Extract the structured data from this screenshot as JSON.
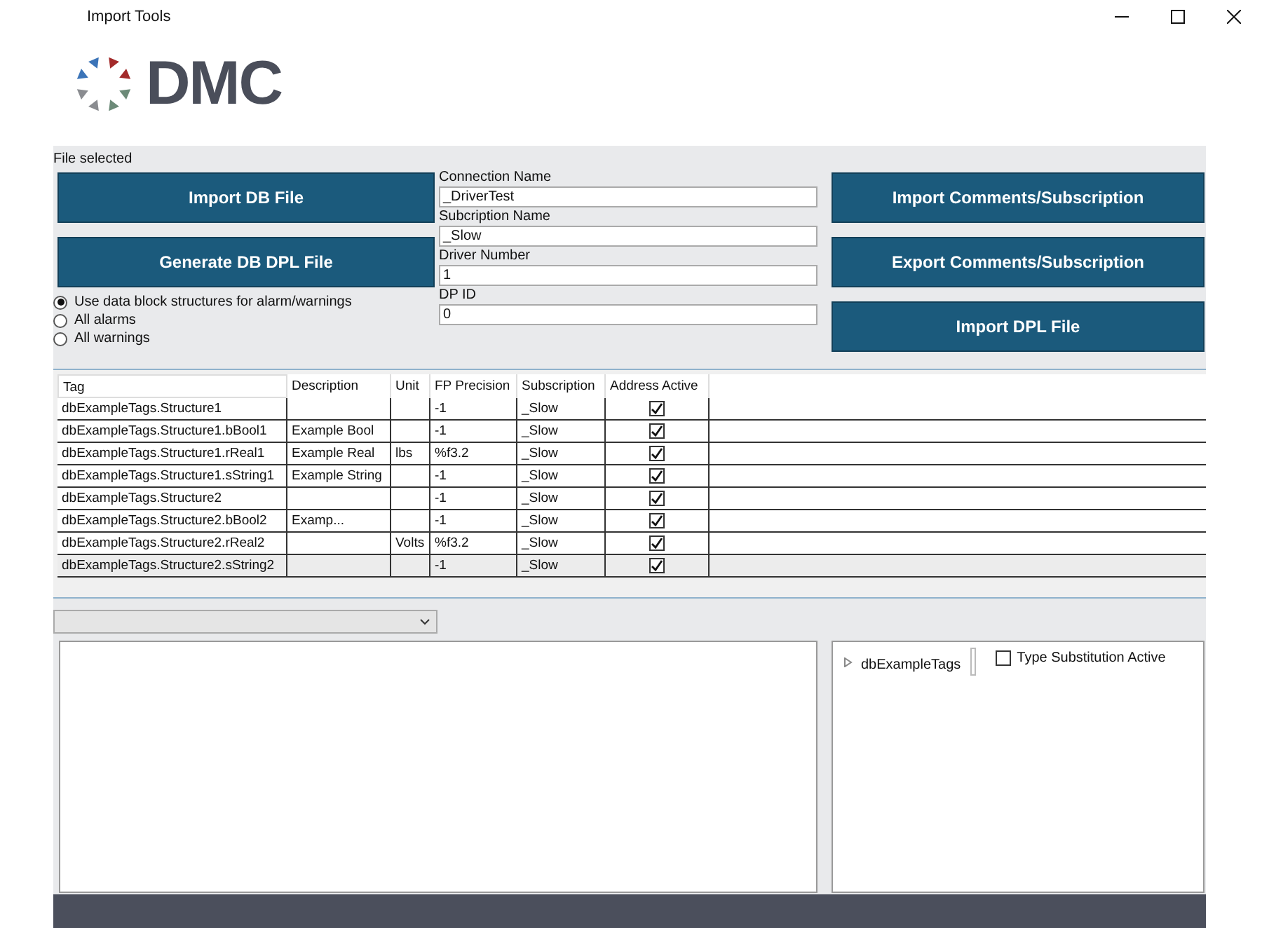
{
  "window": {
    "title": "Import Tools"
  },
  "logo": {
    "text": "DMC"
  },
  "status": "File selected",
  "left_buttons": [
    "Import DB File",
    "Generate DB DPL File"
  ],
  "radios": [
    {
      "label": "Use data block structures for alarm/warnings",
      "selected": true
    },
    {
      "label": "All alarms",
      "selected": false
    },
    {
      "label": "All warnings",
      "selected": false
    }
  ],
  "fields": [
    {
      "label": "Connection Name",
      "value": "_DriverTest"
    },
    {
      "label": "Subcription Name",
      "value": "_Slow"
    },
    {
      "label": "Driver Number",
      "value": "1"
    },
    {
      "label": "DP ID",
      "value": "0"
    }
  ],
  "right_buttons": [
    "Import Comments/Subscription",
    "Export Comments/Subscription",
    "Import DPL File"
  ],
  "table": {
    "columns": [
      "Tag",
      "Description",
      "Unit",
      "FP Precision",
      "Subscription",
      "Address Active"
    ],
    "rows": [
      {
        "tag": "dbExampleTags.Structure1",
        "description": "",
        "unit": "",
        "precision": "-1",
        "subscription": "_Slow",
        "checked": true,
        "selected": false
      },
      {
        "tag": "dbExampleTags.Structure1.bBool1",
        "description": "Example Bool",
        "unit": "",
        "precision": "-1",
        "subscription": "_Slow",
        "checked": true,
        "selected": false
      },
      {
        "tag": "dbExampleTags.Structure1.rReal1",
        "description": "Example Real",
        "unit": "lbs",
        "precision": "%f3.2",
        "subscription": "_Slow",
        "checked": true,
        "selected": false
      },
      {
        "tag": "dbExampleTags.Structure1.sString1",
        "description": "Example String",
        "unit": "",
        "precision": "-1",
        "subscription": "_Slow",
        "checked": true,
        "selected": false
      },
      {
        "tag": "dbExampleTags.Structure2",
        "description": "",
        "unit": "",
        "precision": "-1",
        "subscription": "_Slow",
        "checked": true,
        "selected": false
      },
      {
        "tag": "dbExampleTags.Structure2.bBool2",
        "description": "Examp...",
        "unit": "",
        "precision": "-1",
        "subscription": "_Slow",
        "checked": true,
        "selected": false
      },
      {
        "tag": "dbExampleTags.Structure2.rReal2",
        "description": "",
        "unit": "Volts",
        "precision": "%f3.2",
        "subscription": "_Slow",
        "checked": true,
        "selected": false
      },
      {
        "tag": "dbExampleTags.Structure2.sString2",
        "description": "",
        "unit": "",
        "precision": "-1",
        "subscription": "_Slow",
        "checked": true,
        "selected": true
      }
    ]
  },
  "tree": {
    "items": [
      {
        "label": "dbExampleTags",
        "expanded": false
      }
    ]
  },
  "type_substitution": {
    "label": "Type Substitution Active",
    "checked": false
  }
}
